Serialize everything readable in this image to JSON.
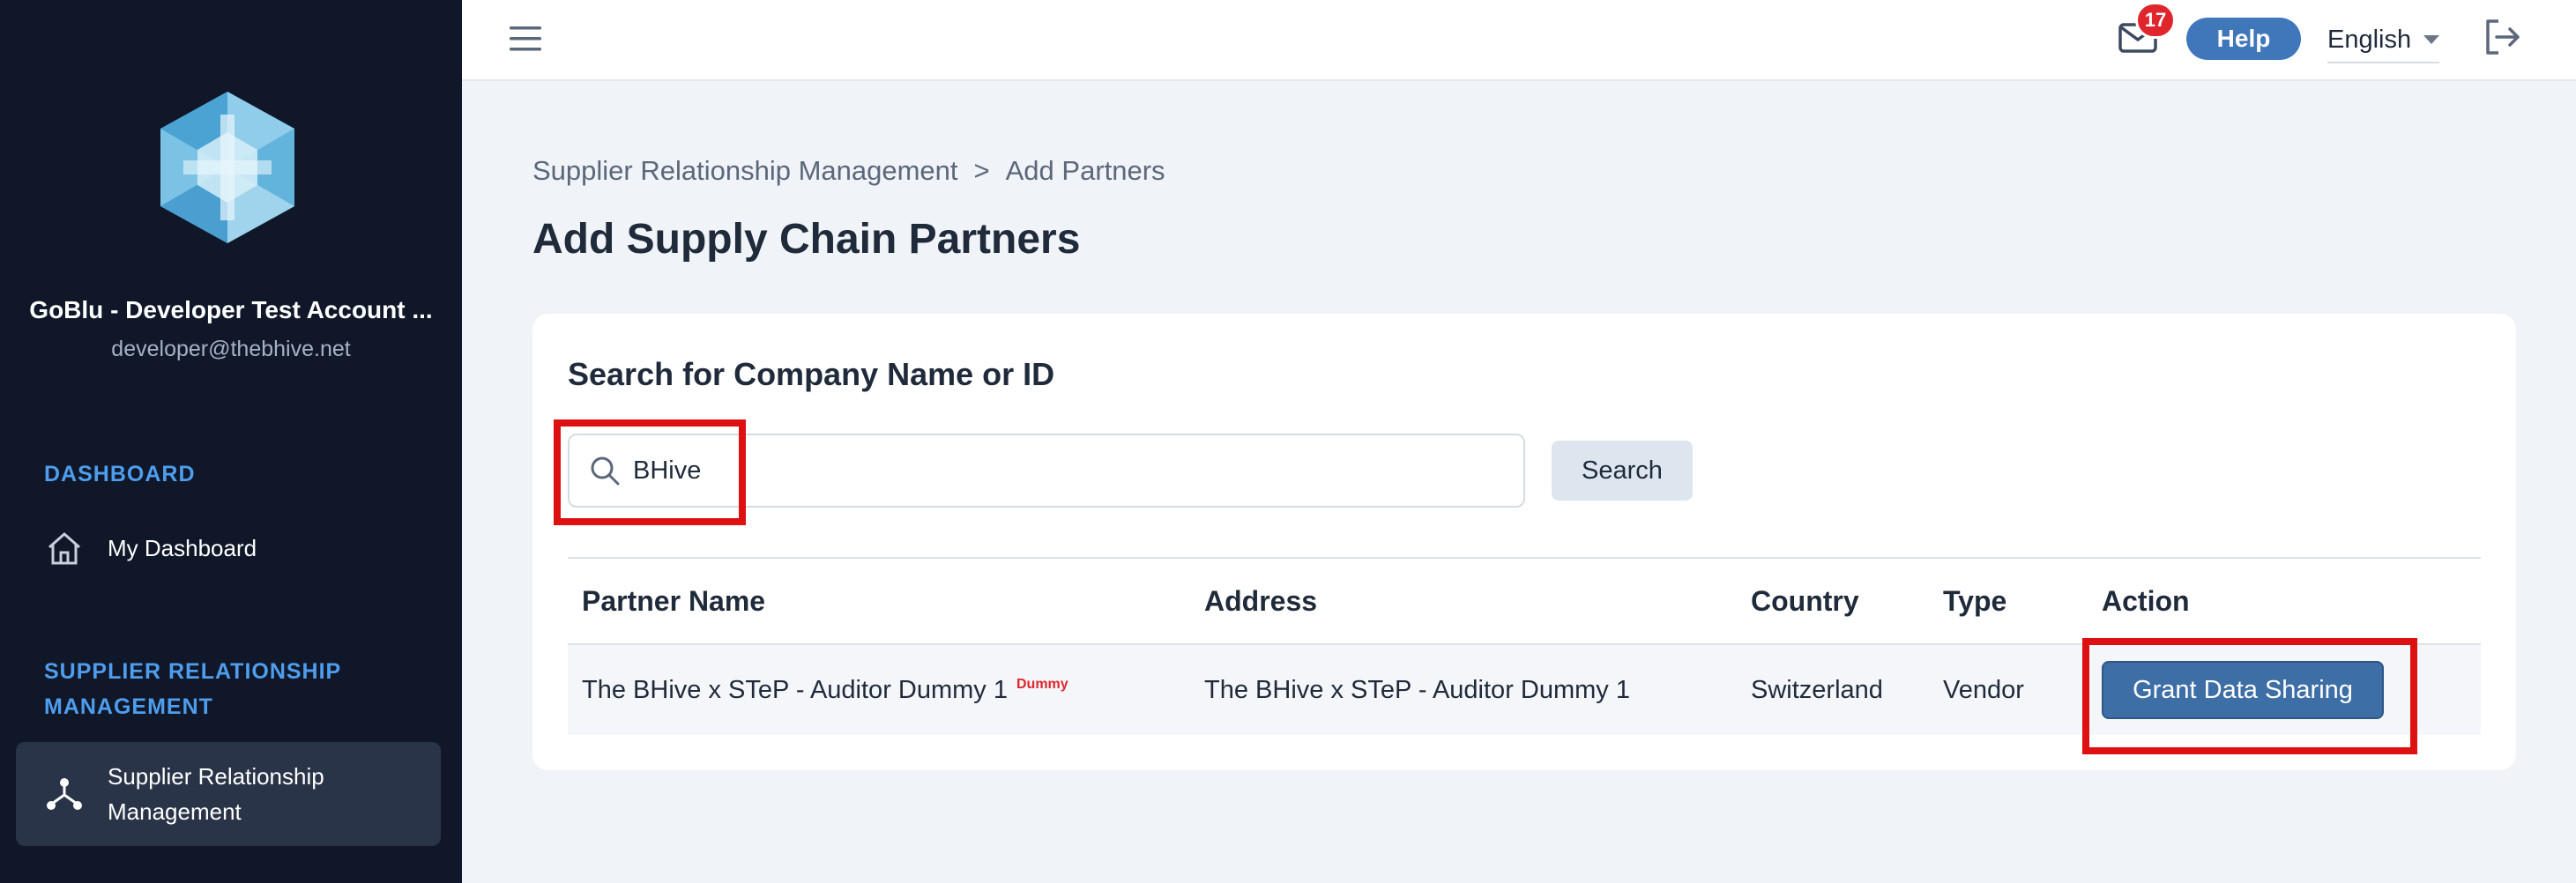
{
  "sidebar": {
    "account_name": "GoBlu - Developer Test Account ...",
    "account_email": "developer@thebhive.net",
    "sections": [
      {
        "label": "DASHBOARD"
      },
      {
        "label_line1": "SUPPLIER RELATIONSHIP",
        "label_line2": "MANAGEMENT"
      }
    ],
    "items": [
      {
        "label": "My Dashboard",
        "icon": "home-icon"
      },
      {
        "label_line1": "Supplier Relationship",
        "label_line2": "Management",
        "icon": "network-icon",
        "active": true
      }
    ]
  },
  "topbar": {
    "notification_count": "17",
    "help_label": "Help",
    "language": "English"
  },
  "breadcrumb": {
    "parent": "Supplier Relationship Management",
    "separator": ">",
    "current": "Add Partners"
  },
  "page": {
    "title": "Add Supply Chain Partners"
  },
  "search": {
    "heading": "Search for Company Name or ID",
    "value": "BHive",
    "button_label": "Search"
  },
  "table": {
    "headers": [
      "Partner Name",
      "Address",
      "Country",
      "Type",
      "Action"
    ],
    "rows": [
      {
        "partner_name": "The BHive x STeP - Auditor Dummy 1",
        "tag": "Dummy",
        "address": "The BHive x STeP - Auditor Dummy 1",
        "country": "Switzerland",
        "type": "Vendor",
        "action_label": "Grant Data Sharing"
      }
    ]
  },
  "colors": {
    "sidebar_bg": "#0f1729",
    "accent": "#3f77ba",
    "section_label": "#4f9ded",
    "badge": "#e0262c",
    "highlight": "#dd1111"
  }
}
